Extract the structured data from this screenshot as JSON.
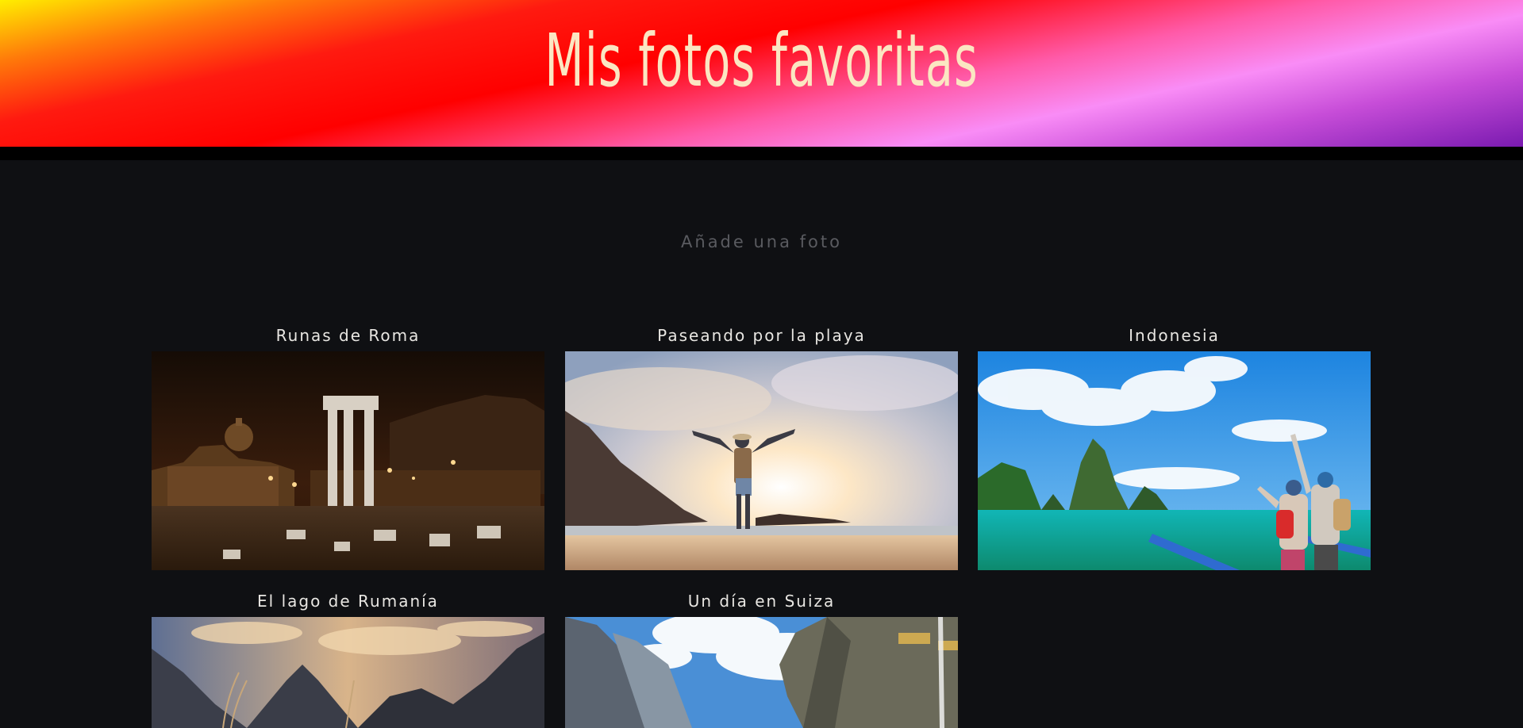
{
  "header": {
    "title": "Mis fotos favoritas"
  },
  "add_photo": {
    "label": "Añade una foto"
  },
  "gallery": {
    "items": [
      {
        "title": "Runas de Roma"
      },
      {
        "title": "Paseando por la playa"
      },
      {
        "title": "Indonesia"
      },
      {
        "title": "El lago de Rumanía"
      },
      {
        "title": "Un día en Suiza"
      }
    ]
  },
  "colors": {
    "background": "#0f1013",
    "title_color": "#fbe6c2",
    "card_text": "#e8e6e2",
    "muted_text": "#5a5b60"
  }
}
